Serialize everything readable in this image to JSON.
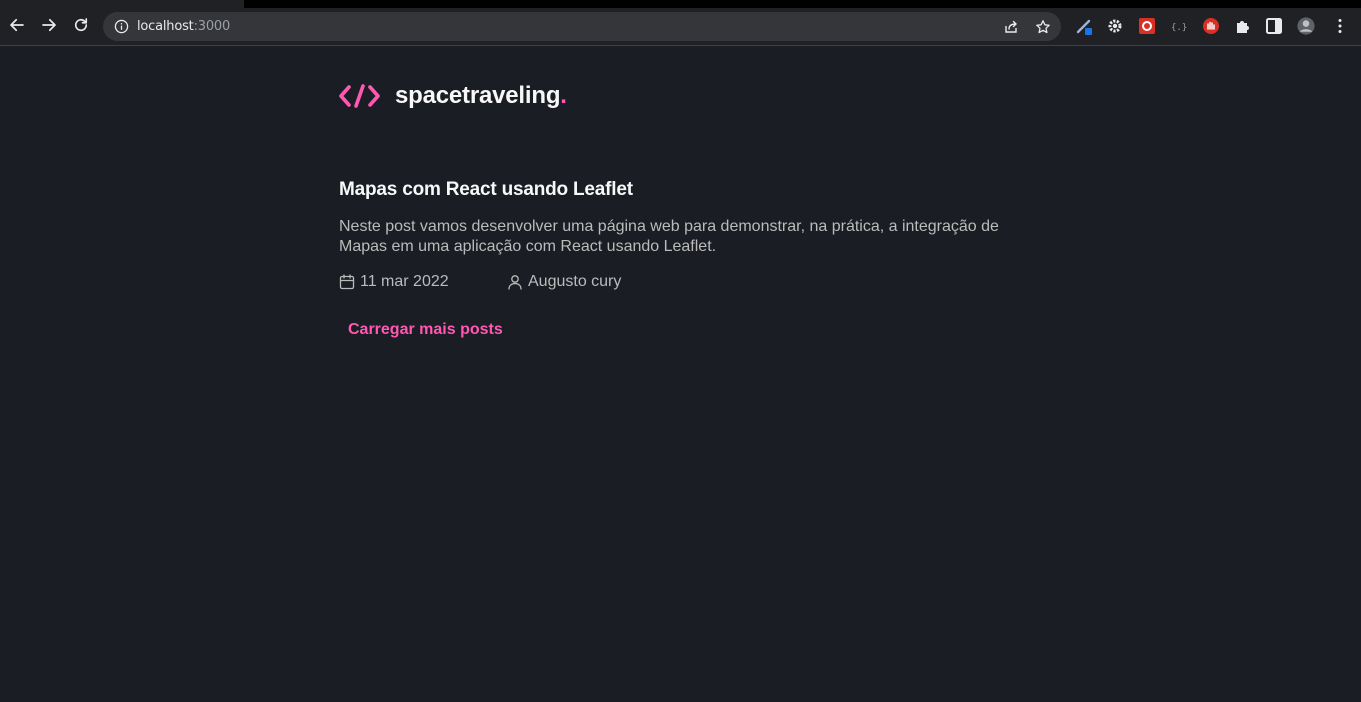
{
  "browser": {
    "url_host": "localhost",
    "url_port": ":3000"
  },
  "brand": {
    "name": "spacetraveling",
    "dot": ".",
    "accent": "#ff57b2"
  },
  "posts": [
    {
      "title": "Mapas com React usando Leaflet",
      "subtitle": "Neste post vamos desenvolver uma página web para demonstrar, na prática, a integração de Mapas em uma aplicação com React usando Leaflet.",
      "date": "11 mar 2022",
      "author": "Augusto cury"
    }
  ],
  "actions": {
    "load_more_label": "Carregar mais posts"
  },
  "icons": {
    "back": "back-arrow-icon",
    "forward": "forward-arrow-icon",
    "reload": "reload-icon",
    "info": "info-icon",
    "share": "share-icon",
    "bookmark": "star-icon",
    "calendar": "calendar-icon",
    "user": "user-icon",
    "extensions": "puzzle-icon",
    "sidepanel": "side-panel-icon",
    "menu": "kebab-menu-icon"
  }
}
